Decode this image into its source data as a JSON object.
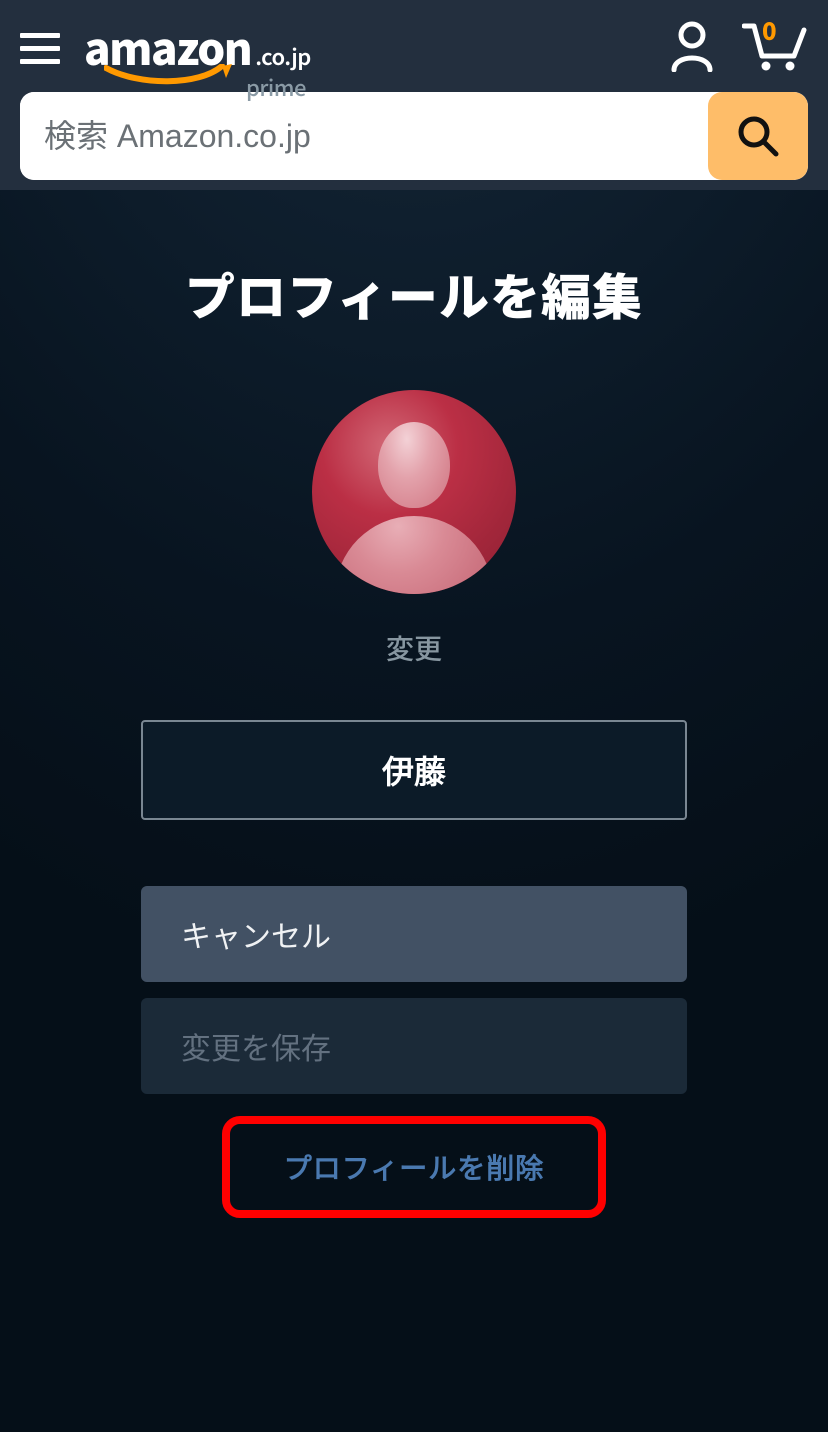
{
  "header": {
    "logo_main": "amazon",
    "logo_tld": ".co.jp",
    "logo_sub": "prime",
    "cart_count": "0"
  },
  "search": {
    "placeholder": "検索 Amazon.co.jp",
    "value": ""
  },
  "page": {
    "title": "プロフィールを編集",
    "change_avatar": "変更",
    "profile_name": "伊藤",
    "cancel": "キャンセル",
    "save": "変更を保存",
    "delete": "プロフィールを削除"
  },
  "colors": {
    "header_bg": "#232f3e",
    "accent_orange": "#ff9900",
    "search_btn": "#febd69",
    "highlight_border": "#ff0000",
    "delete_text": "#4a79b0"
  }
}
